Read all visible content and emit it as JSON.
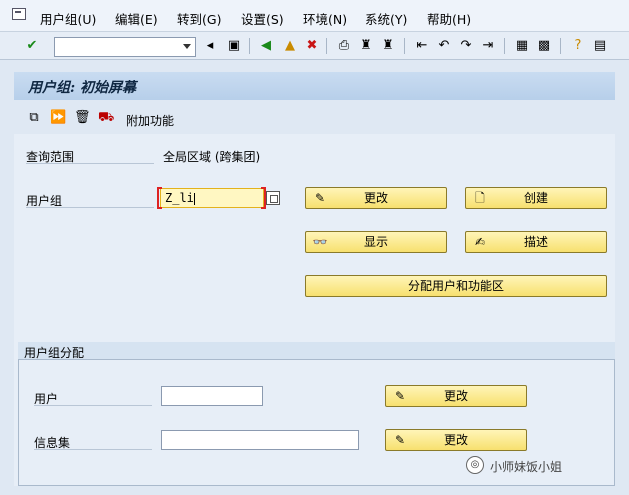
{
  "menu": {
    "items": [
      "用户组(U)",
      "编辑(E)",
      "转到(G)",
      "设置(S)",
      "环境(N)",
      "系统(Y)",
      "帮助(H)"
    ]
  },
  "toolbar": {
    "command_value": ""
  },
  "title": "用户组: 初始屏幕",
  "app_toolbar": {
    "extra_label": "附加功能"
  },
  "form": {
    "scope_label": "查询范围",
    "scope_value": "全局区域 (跨集团)",
    "user_group_label": "用户组",
    "user_group_value": "Z_li"
  },
  "buttons": {
    "change": "更改",
    "create": "创建",
    "display": "显示",
    "describe": "描述",
    "assign": "分配用户和功能区"
  },
  "group_box": {
    "title": "用户组分配",
    "user_label": "用户",
    "user_value": "",
    "infoset_label": "信息集",
    "infoset_value": "",
    "change_user": "更改",
    "change_infoset": "更改"
  },
  "watermark": "小师妹饭小姐",
  "colors": {
    "button_yellow": "#f7e06f",
    "title_blue": "#b7cfea",
    "panel": "#e7eef7"
  },
  "icons": [
    "app-menu-icon",
    "check-icon",
    "back-icon",
    "save-icon",
    "back-green-icon",
    "exit-icon",
    "cancel-icon",
    "print-icon",
    "find-icon",
    "find-next-icon",
    "first-page-icon",
    "prev-page-icon",
    "next-page-icon",
    "last-page-icon",
    "layout-icon",
    "shortcut-icon",
    "help-icon",
    "customize-icon",
    "copy-icon",
    "execute-icon",
    "delete-icon",
    "transport-icon",
    "pencil-icon",
    "new-doc-icon",
    "glasses-icon",
    "describe-icon"
  ]
}
